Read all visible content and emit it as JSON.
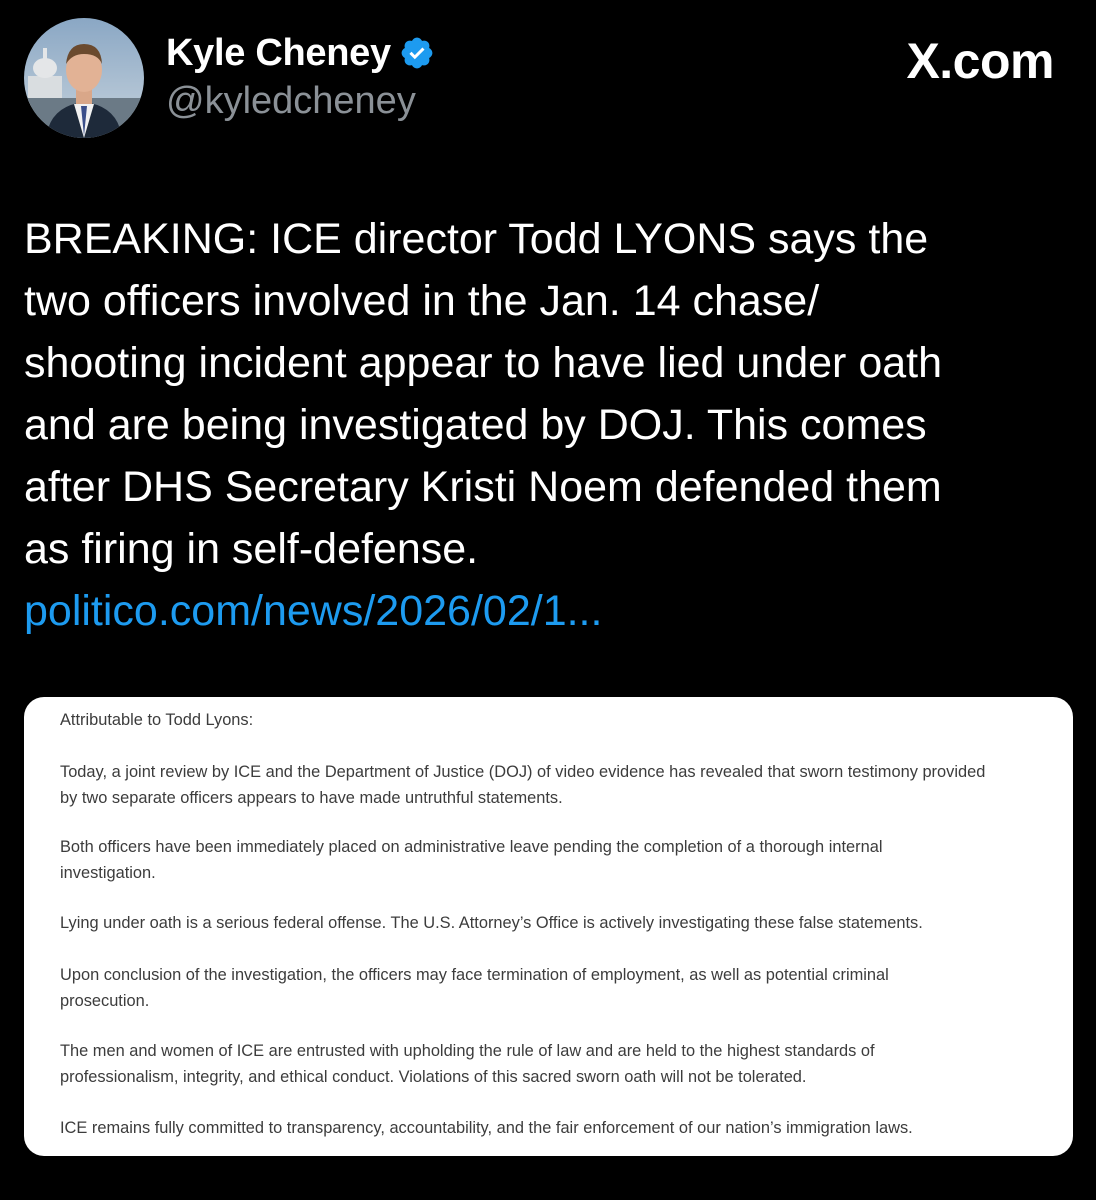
{
  "author": {
    "display_name": "Kyle Cheney",
    "handle": "@kyledcheney"
  },
  "brand": {
    "label": "X.com"
  },
  "tweet": {
    "text_lines": [
      "BREAKING: ICE director Todd LYONS says the",
      "two officers involved in the Jan. 14 chase/",
      "shooting incident appear to have lied under oath",
      "and are being investigated by DOJ. This comes",
      "after DHS Secretary Kristi Noem defended them",
      "as firing in self-defense."
    ],
    "link": "politico.com/news/2026/02/1..."
  },
  "statement": {
    "heading": "Attributable to Todd Lyons:",
    "paragraphs": [
      {
        "lines": [
          "Today, a joint review by ICE and the Department of Justice (DOJ) of video evidence has revealed that sworn testimony provided",
          "by two separate officers appears to have made untruthful statements."
        ]
      },
      {
        "lines": [
          "Both officers have been immediately placed on administrative leave pending the completion of a thorough internal",
          "investigation."
        ]
      },
      {
        "lines": [
          "Lying under oath is a serious federal offense. The U.S. Attorney’s Office is actively investigating these false statements."
        ]
      },
      {
        "lines": [
          "Upon conclusion of the investigation, the officers may face termination of employment, as well as potential criminal",
          "prosecution."
        ]
      },
      {
        "lines": [
          "The men and women of ICE are entrusted with upholding the rule of law and are held to the highest standards of",
          "professionalism, integrity, and ethical conduct. Violations of this sacred sworn oath will not be tolerated."
        ]
      },
      {
        "lines": [
          "ICE remains fully committed to transparency, accountability, and the fair enforcement of our nation’s immigration laws."
        ]
      }
    ]
  },
  "icons": {
    "verified": "verified-badge-icon",
    "avatar": "profile-photo"
  },
  "colors": {
    "background": "#000000",
    "text_primary": "#ffffff",
    "text_secondary": "#8b9197",
    "link": "#1d9bf0",
    "verified_badge": "#1d9bf0",
    "card_background": "#ffffff"
  }
}
